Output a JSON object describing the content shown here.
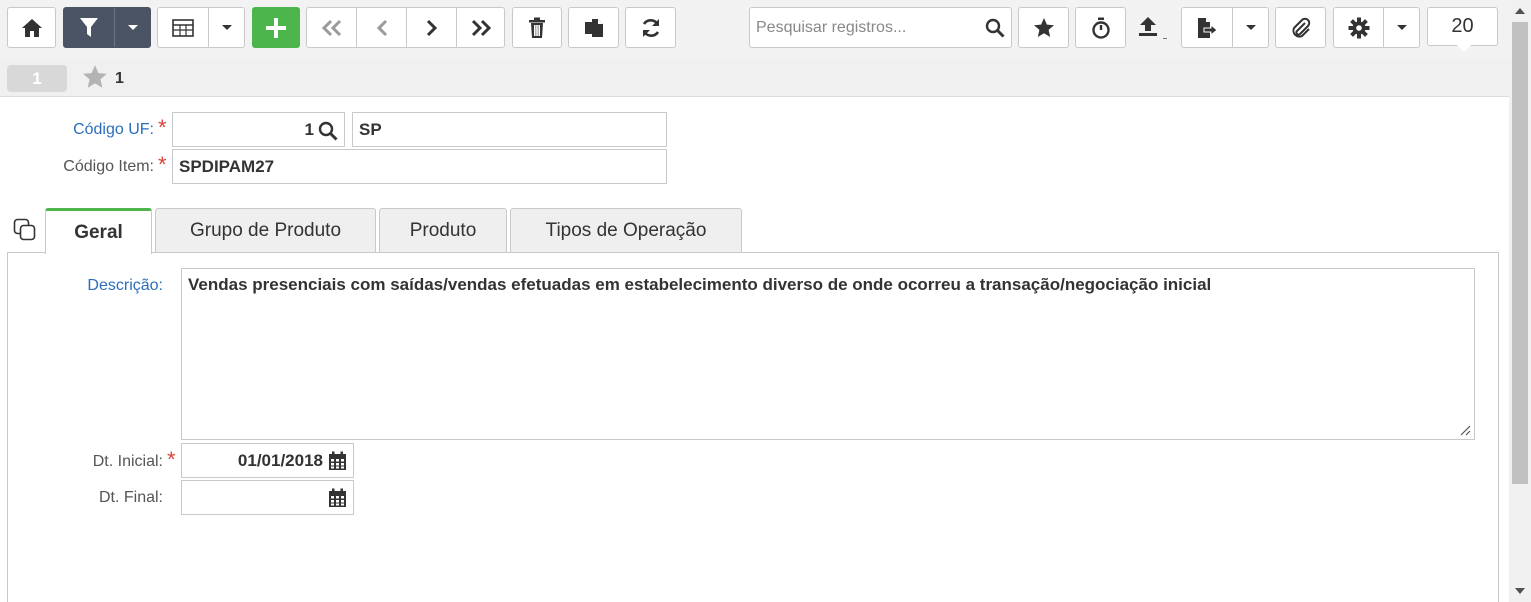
{
  "toolbar": {
    "buttons": [
      {
        "name": "home",
        "icon": "home-icon"
      },
      {
        "name": "filter",
        "icon": "filter-icon"
      },
      {
        "name": "filter-menu",
        "icon": "caret-down-icon"
      },
      {
        "name": "grid-view",
        "icon": "table-icon"
      },
      {
        "name": "grid-menu",
        "icon": "caret-down-icon"
      },
      {
        "name": "add",
        "icon": "plus-icon"
      },
      {
        "name": "first-record",
        "icon": "double-chevron-left-icon"
      },
      {
        "name": "previous-record",
        "icon": "chevron-left-icon"
      },
      {
        "name": "next-record",
        "icon": "chevron-right-icon"
      },
      {
        "name": "last-record",
        "icon": "double-chevron-right-icon"
      },
      {
        "name": "delete",
        "icon": "trash-icon"
      },
      {
        "name": "duplicate",
        "icon": "copy-icon"
      },
      {
        "name": "refresh",
        "icon": "refresh-icon"
      },
      {
        "name": "favorite",
        "icon": "star-icon"
      },
      {
        "name": "timer",
        "icon": "stopwatch-icon"
      },
      {
        "name": "upload",
        "icon": "upload-icon"
      },
      {
        "name": "export",
        "icon": "file-export-icon"
      },
      {
        "name": "export-menu",
        "icon": "caret-down-icon"
      },
      {
        "name": "attach",
        "icon": "paperclip-icon"
      },
      {
        "name": "settings",
        "icon": "gear-icon"
      },
      {
        "name": "settings-menu",
        "icon": "caret-down-icon"
      }
    ],
    "search_placeholder": "Pesquisar registros...",
    "page_size": "20"
  },
  "record_bar": {
    "record_number": "1",
    "favorite_count": "1"
  },
  "form": {
    "codigo_uf": {
      "label": "Código UF:",
      "value": "1",
      "description": "SP",
      "required": true
    },
    "codigo_item": {
      "label": "Código Item:",
      "value": "SPDIPAM27",
      "required": true
    }
  },
  "tabs": [
    {
      "label": "Geral",
      "active": true
    },
    {
      "label": "Grupo de Produto",
      "active": false
    },
    {
      "label": "Produto",
      "active": false
    },
    {
      "label": "Tipos de Operação",
      "active": false
    }
  ],
  "geral": {
    "descricao": {
      "label": "Descrição:",
      "value": "Vendas presenciais com saídas/vendas efetuadas em estabelecimento diverso de onde ocorreu a transação/negociação inicial"
    },
    "dt_inicial": {
      "label": "Dt. Inicial:",
      "value": "01/01/2018",
      "required": true
    },
    "dt_final": {
      "label": "Dt. Final:",
      "value": ""
    }
  },
  "colors": {
    "toolbar_bg": "#f2f2f2",
    "filter_button_bg": "#4a5464",
    "add_button_bg": "#4cb54c",
    "active_tab_accent": "#4cb54c",
    "link_label": "#2a6ebd",
    "required_star": "#d9453b"
  }
}
